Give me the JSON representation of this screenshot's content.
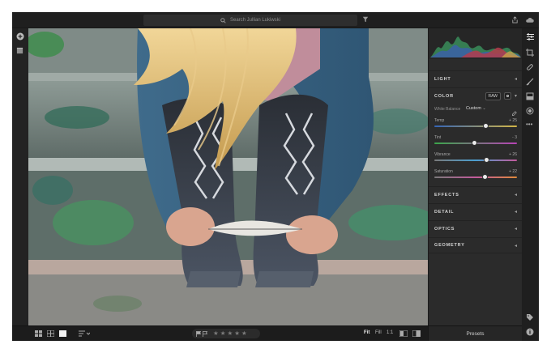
{
  "search": {
    "placeholder": "Search Jullian Lukiwski"
  },
  "panel": {
    "sections": {
      "light": "LIGHT",
      "color": "COLOR",
      "effects": "EFFECTS",
      "detail": "DETAIL",
      "optics": "OPTICS",
      "geometry": "GEOMETRY"
    },
    "color": {
      "raw_button": "RAW",
      "white_balance_label": "White Balance",
      "white_balance_value": "Custom",
      "sliders": [
        {
          "name": "Temp",
          "value": "+ 25",
          "level": 0.62
        },
        {
          "name": "Tint",
          "value": "- 3",
          "level": 0.49
        },
        {
          "name": "Vibrance",
          "value": "+ 26",
          "level": 0.63
        },
        {
          "name": "Saturation",
          "value": "+ 22",
          "level": 0.61
        }
      ]
    }
  },
  "bottom": {
    "zoom": [
      "Fit",
      "Fill",
      "1:1"
    ],
    "rating": 0,
    "presets_label": "Presets"
  },
  "colors": {
    "accent_knob": "#ececec",
    "panel_bg": "#2b2b2b",
    "photo_green": "#3c8c63"
  }
}
